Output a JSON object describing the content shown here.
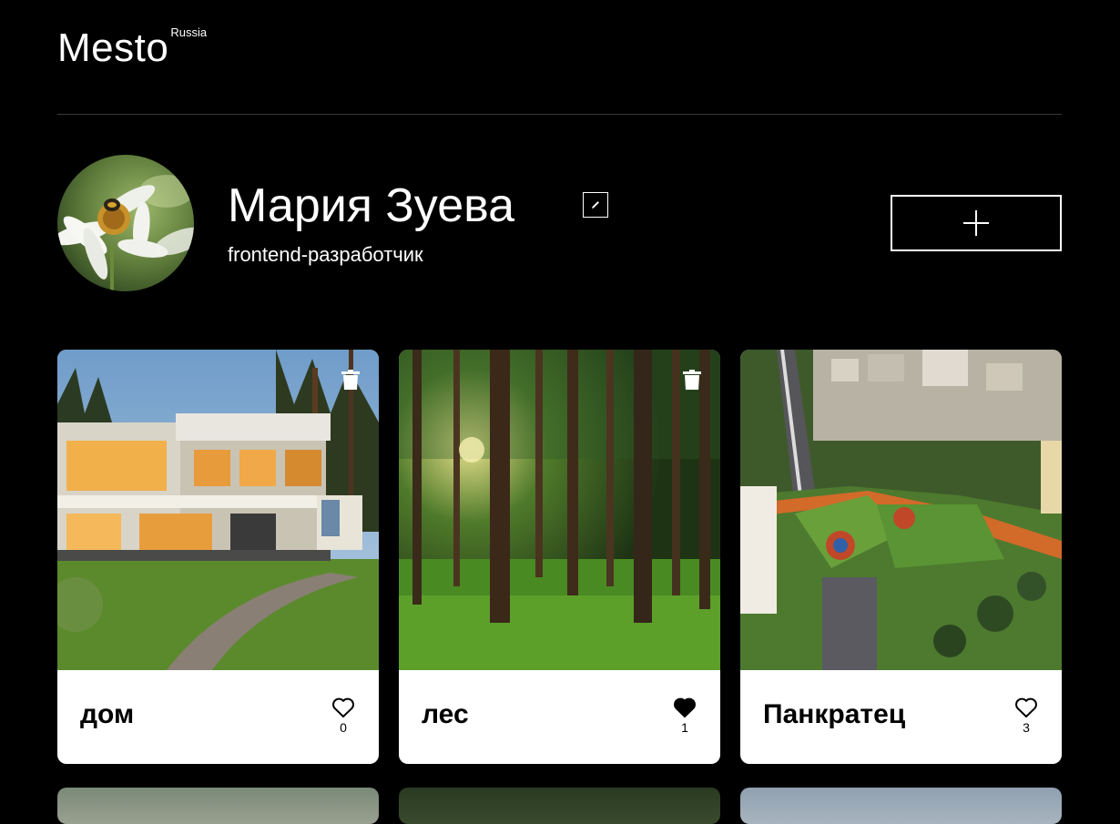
{
  "header": {
    "logo": "Mesto",
    "region": "Russia"
  },
  "profile": {
    "name": "Мария Зуева",
    "about": "frontend-разработчик",
    "avatar_icon": "daisy-with-bee-photo",
    "edit_icon": "pencil-icon",
    "add_icon": "plus-icon"
  },
  "cards": [
    {
      "title": "дом",
      "likes": "0",
      "liked": false,
      "deletable": true,
      "image": "modern-house-photo"
    },
    {
      "title": "лес",
      "likes": "1",
      "liked": true,
      "deletable": true,
      "image": "forest-photo"
    },
    {
      "title": "Панкратец",
      "likes": "3",
      "liked": false,
      "deletable": false,
      "image": "aerial-gardens-photo"
    }
  ],
  "colors": {
    "background": "#000000",
    "card": "#ffffff",
    "text": "#ffffff",
    "card_text": "#000000",
    "divider": "#545454"
  }
}
